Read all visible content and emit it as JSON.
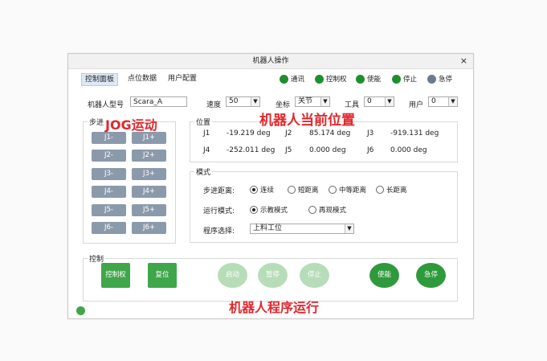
{
  "window": {
    "title": "机器人操作",
    "close": "×"
  },
  "tabs": [
    "控制面板",
    "点位数据",
    "用户配置"
  ],
  "indicators": [
    {
      "label": "通讯",
      "color": "#1f8f2e"
    },
    {
      "label": "控制权",
      "color": "#1f8f2e"
    },
    {
      "label": "使能",
      "color": "#1f8f2e"
    },
    {
      "label": "停止",
      "color": "#1f8f2e"
    },
    {
      "label": "急停",
      "color": "#6b7a8c"
    }
  ],
  "config": {
    "model_label": "机器人型号",
    "model_value": "Scara_A",
    "speed_label": "速度",
    "speed_value": "50",
    "coord_label": "坐标",
    "coord_value": "关节",
    "tool_label": "工具",
    "tool_value": "0",
    "user_label": "用户",
    "user_value": "0"
  },
  "jog": {
    "title": "步进",
    "buttons": [
      "J1-",
      "J1+",
      "J2-",
      "J2+",
      "J3-",
      "J3+",
      "J4-",
      "J4+",
      "J5-",
      "J5+",
      "J6-",
      "J6+"
    ]
  },
  "position": {
    "title": "位置",
    "rows": [
      [
        {
          "j": "J1",
          "v": "-19.219 deg"
        },
        {
          "j": "J2",
          "v": "85.174 deg"
        },
        {
          "j": "J3",
          "v": "-919.131 deg"
        }
      ],
      [
        {
          "j": "J4",
          "v": "-252.011 deg"
        },
        {
          "j": "J5",
          "v": "0.000 deg"
        },
        {
          "j": "J6",
          "v": "0.000 deg"
        }
      ]
    ]
  },
  "mode": {
    "title": "模式",
    "step_label": "步进距离:",
    "step_options": [
      "连续",
      "短距离",
      "中等距离",
      "长距离"
    ],
    "run_label": "运行模式:",
    "run_options": [
      "示教模式",
      "再现模式"
    ],
    "prog_label": "程序选择:",
    "prog_value": "上料工位"
  },
  "control": {
    "title": "控制",
    "btn_control": "控制权",
    "btn_reset": "复位",
    "btn_start": "启动",
    "btn_pause": "暂停",
    "btn_stop": "停止",
    "btn_enable": "使能",
    "btn_estop": "急停"
  },
  "colors": {
    "green": "#3fa64a",
    "pale_green": "#b6ddb8",
    "dark_green": "#2f9a3b",
    "jog_gray": "#8b9aab",
    "annotation_red": "#e0282d"
  },
  "annotations": {
    "jog": "JOG运动",
    "position": "机器人当前位置",
    "program": "机器人程序运行"
  }
}
